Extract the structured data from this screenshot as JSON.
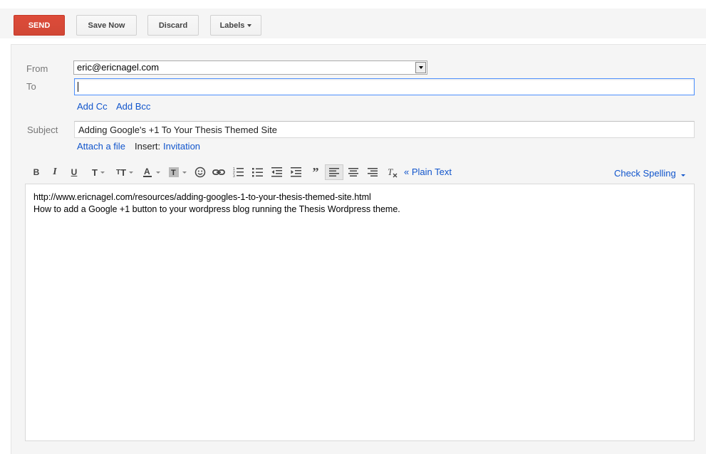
{
  "toolbar": {
    "send_label": "SEND",
    "save_label": "Save Now",
    "discard_label": "Discard",
    "labels_label": "Labels"
  },
  "from": {
    "label": "From",
    "value": "eric@ericnagel.com"
  },
  "to": {
    "label": "To",
    "value": ""
  },
  "add_cc": "Add Cc",
  "add_bcc": "Add Bcc",
  "subject": {
    "label": "Subject",
    "value": "Adding Google's +1 To Your Thesis Themed Site"
  },
  "attach_label": "Attach a file",
  "insert_label": "Insert:",
  "invitation_label": "Invitation",
  "format": {
    "plain_text_label": "« Plain Text",
    "check_spelling_label": "Check Spelling",
    "icons": [
      "bold-icon",
      "italic-icon",
      "underline-icon",
      "font-icon",
      "font-size-icon",
      "text-color-icon",
      "highlight-color-icon",
      "emoji-icon",
      "link-icon",
      "numbered-list-icon",
      "bulleted-list-icon",
      "indent-less-icon",
      "indent-more-icon",
      "quote-icon",
      "align-left-icon",
      "align-center-icon",
      "align-right-icon",
      "remove-formatting-icon"
    ]
  },
  "body": {
    "line1": "http://www.ericnagel.com/resources/adding-googles-1-to-your-thesis-themed-site.html",
    "line2": "How to add a Google +1 button to your wordpress blog running the Thesis Wordpress theme."
  },
  "colors": {
    "send": "#d14836",
    "link": "#1155cc",
    "focus": "#4d90fe"
  }
}
